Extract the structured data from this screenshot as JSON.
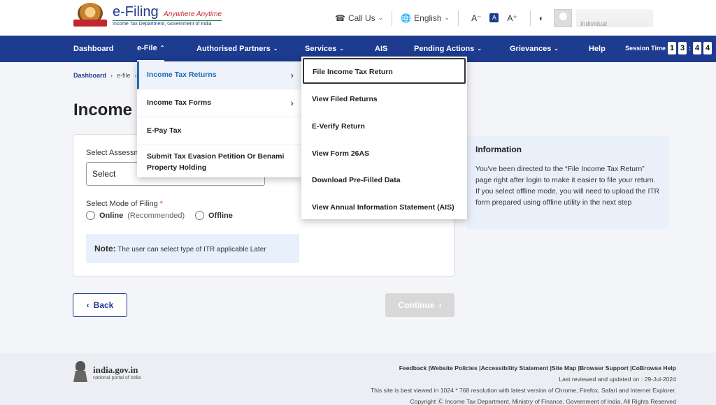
{
  "header": {
    "logo_title": "e-Filing",
    "logo_tagline": "Anywhere Anytime",
    "logo_sub": "Income Tax Department, Government of India",
    "call_us": "Call Us",
    "language": "English",
    "font_decrease": "A⁻",
    "font_normal": "A",
    "font_increase": "A⁺",
    "user_type": "Individual"
  },
  "nav": {
    "items": [
      "Dashboard",
      "e-File",
      "Authorised Partners",
      "Services",
      "AIS",
      "Pending Actions",
      "Grievances",
      "Help"
    ],
    "session_label": "Session Time",
    "session_digits": [
      "1",
      "3",
      "4",
      "4"
    ]
  },
  "breadcrumb": [
    "Dashboard",
    "e-file"
  ],
  "page": {
    "title": "Income Tax Returns",
    "assessment_label": "Select Assessment Year",
    "select_placeholder": "Select",
    "mode_label": "Select Mode of Filing",
    "online": "Online",
    "online_hint": "(Recommended)",
    "offline": "Offline",
    "note_label": "Note:",
    "note_text": " The user can select type of ITR applicable Later"
  },
  "info": {
    "title": "Information",
    "body": "You've been directed to the “File Income Tax Return” page right after login to make it easier to file your return.",
    "body2": "If you select offline mode, you will need to upload the ITR form prepared using offline utility in the next step"
  },
  "buttons": {
    "back": "Back",
    "continue": "Continue"
  },
  "efile_menu": [
    "Income Tax Returns",
    "Income Tax Forms",
    "E-Pay Tax",
    "Submit Tax Evasion Petition Or Benami Property Holding"
  ],
  "itr_submenu": [
    "File Income Tax Return",
    "View Filed Returns",
    "E-Verify Return",
    "View Form 26AS",
    "Download Pre-Filled Data",
    "View Annual Information Statement (AIS)"
  ],
  "footer": {
    "gov_title": "india.gov.in",
    "gov_sub": "national portal of india",
    "links": "Feedback |Website Policies |Accessibility Statement |Site Map |Browser Support |CoBrowse Help",
    "updated": "Last reviewed and updated on : 29-Jul-2024",
    "resolution": "This site is best viewed in 1024 * 768 resolution with latest version of Chrome, Firefox, Safari and Internet Explorer.",
    "copyright": "Copyright Ⓒ Income Tax Department, Ministry of Finance, Government of India. All Rights Reserved"
  },
  "colors": {
    "primary": "#1d3b8f",
    "accent": "#c2262e",
    "link_active": "#1d6bb8"
  }
}
